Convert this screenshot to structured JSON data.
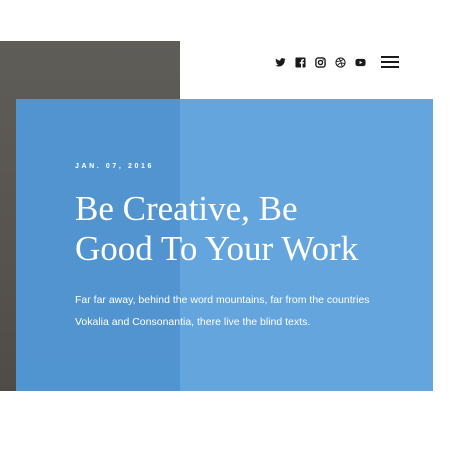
{
  "header": {
    "social_icons": [
      "twitter-icon",
      "facebook-icon",
      "instagram-icon",
      "dribbble-icon",
      "youtube-icon"
    ],
    "menu_icon": "hamburger-menu-icon"
  },
  "hero": {
    "date": "JAN. 07, 2016",
    "title_line1": "Be Creative, Be",
    "title_line2": "Good To Your Work",
    "excerpt_line1": "Far far away, behind the word mountains, far from the countries",
    "excerpt_line2": "Vokalia and Consonantia, there live the blind texts."
  },
  "colors": {
    "accent_blue": "#5aa0dc",
    "photo_dark": "#5a5853",
    "icon_color": "#1a1a1a",
    "background": "#ffffff"
  }
}
